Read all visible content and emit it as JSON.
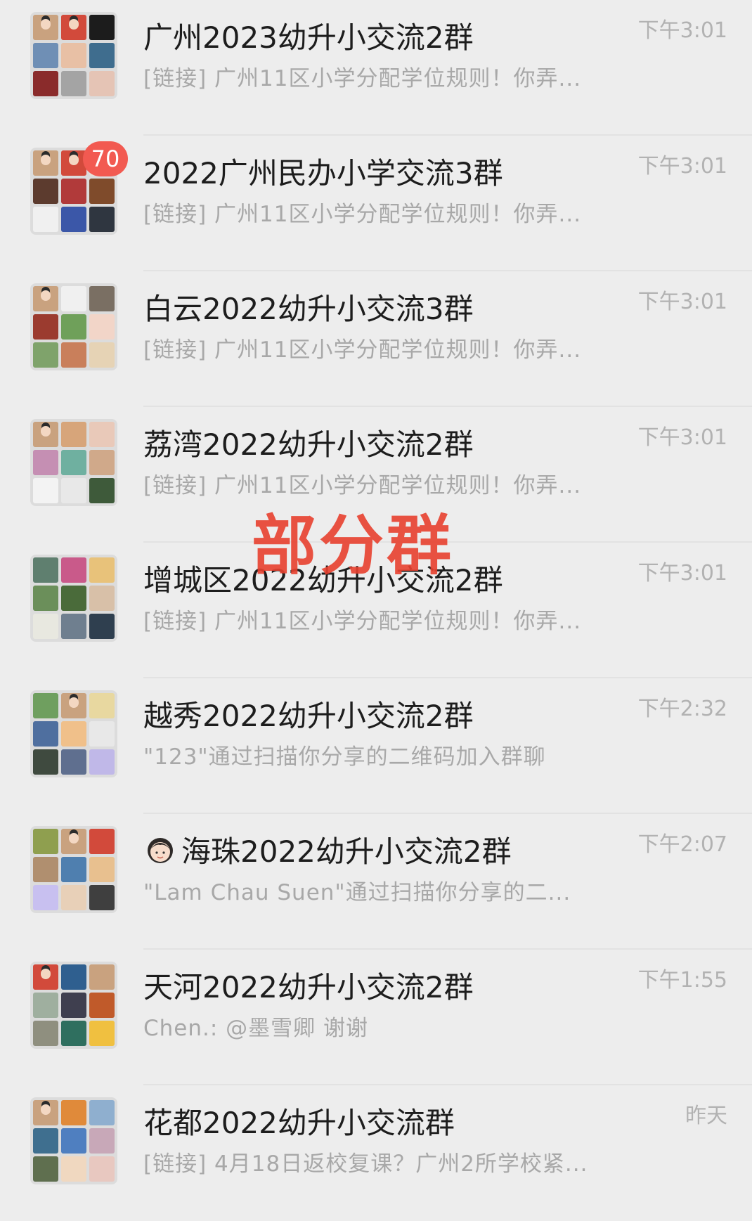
{
  "chats": [
    {
      "name": "广州2023幼升小交流2群",
      "preview": "[链接] 广州11区小学分配学位规则！你弄...",
      "time": "下午3:01",
      "badge": "",
      "tiles": [
        "#c9a27f",
        "#d24a3b",
        "#1c1c1c",
        "#6f8fb5",
        "#e8c0a5",
        "#3f6d8e",
        "#8a2b2b",
        "#a4a4a4",
        "#e5c4b5"
      ]
    },
    {
      "name": "2022广州民办小学交流3群",
      "preview": "[链接] 广州11区小学分配学位规则！你弄...",
      "time": "下午3:01",
      "badge": "70",
      "tiles": [
        "#c9a27f",
        "#d24a3b",
        "#e9e2d8",
        "#5c3b2e",
        "#b13a3a",
        "#7f4b2b",
        "#f0f0f0",
        "#3b57a8",
        "#2f3640"
      ]
    },
    {
      "name": "白云2022幼升小交流3群",
      "preview": "[链接] 广州11区小学分配学位规则！你弄...",
      "time": "下午3:01",
      "badge": "",
      "tiles": [
        "#c9a27f",
        "#f0f0f0",
        "#7a6f63",
        "#9b3b2f",
        "#6fa05a",
        "#f2d5c8",
        "#7fa36b",
        "#c97f5b",
        "#e6d3b5"
      ]
    },
    {
      "name": "荔湾2022幼升小交流2群",
      "preview": "[链接] 广州11区小学分配学位规则！你弄...",
      "time": "下午3:01",
      "badge": "",
      "tiles": [
        "#c9a27f",
        "#d7a57a",
        "#e9c9b9",
        "#c58fb3",
        "#6fb0a0",
        "#d0a98a",
        "#f3f3f3",
        "#e8e8e8",
        "#3e5a3a"
      ]
    },
    {
      "name": "增城区2022幼升小交流2群",
      "preview": "[链接] 广州11区小学分配学位规则！你弄...",
      "time": "下午3:01",
      "badge": "",
      "tiles": [
        "#5f7f6f",
        "#c95a8a",
        "#e8c27a",
        "#6b8f5a",
        "#4a6b3a",
        "#d8c0a8",
        "#e8e8e0",
        "#6f7f8f",
        "#2f3f4f"
      ]
    },
    {
      "name": "越秀2022幼升小交流2群",
      "preview": "\"123\"通过扫描你分享的二维码加入群聊",
      "time": "下午2:32",
      "badge": "",
      "tiles": [
        "#6f9f5f",
        "#c9a27f",
        "#e8d8a0",
        "#4f6f9f",
        "#f0c08a",
        "#e8e8e8",
        "#3f4a3f",
        "#5f6f8f",
        "#c0b8e8"
      ]
    },
    {
      "name": "海珠2022幼升小交流2群",
      "preview": "\"Lam Chau Suen\"通过扫描你分享的二...",
      "time": "下午2:07",
      "badge": "",
      "tiles": [
        "#8f9f4f",
        "#c9a27f",
        "#d24a3b",
        "#b08f6f",
        "#4f7faf",
        "#e8c08f",
        "#c8c0f0",
        "#e8d0b8",
        "#3f3f3f"
      ]
    },
    {
      "name": "天河2022幼升小交流2群",
      "preview": "Chen.: @墨雪卿 谢谢",
      "time": "下午1:55",
      "badge": "",
      "tiles": [
        "#d24a3b",
        "#2f5f8f",
        "#c9a27f",
        "#9faf9f",
        "#3f3f4f",
        "#c05a2a",
        "#8f8f7f",
        "#2f6f5f",
        "#f0c040"
      ]
    },
    {
      "name": "花都2022幼升小交流群",
      "preview": "[链接] 4月18日返校复课？广州2所学校紧...",
      "time": "昨天",
      "badge": "",
      "tiles": [
        "#c9a27f",
        "#e08a3a",
        "#8fafcf",
        "#3f6f8f",
        "#4f7fc0",
        "#c8a8b8",
        "#5f6f4f",
        "#f0d8c0",
        "#e8c8c0"
      ]
    }
  ],
  "watermark": "部分群",
  "special_emoji": "girl-face-icon"
}
